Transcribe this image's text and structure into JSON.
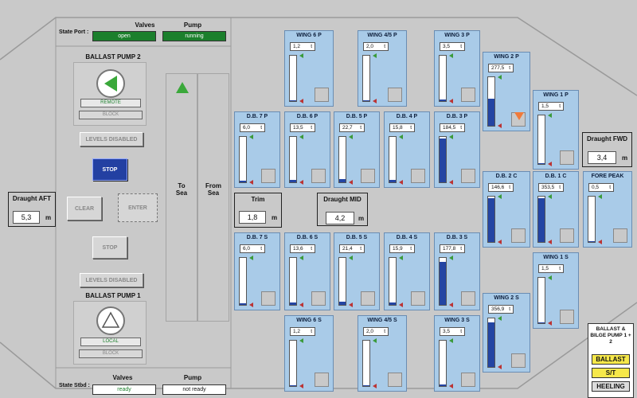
{
  "top_state": {
    "row_label": "State Port :",
    "valves_header": "Valves",
    "pump_header": "Pump",
    "valves_value": "open",
    "pump_value": "running"
  },
  "bottom_state": {
    "row_label": "State Stbd :",
    "valves_header": "Valves",
    "pump_header": "Pump",
    "valves_value": "ready",
    "pump_value": "not ready"
  },
  "pump2": {
    "title": "BALLAST PUMP 2",
    "status": "REMOTE",
    "block": "BLOCK",
    "levels": "LEVELS DISABLED",
    "stop": "STOP"
  },
  "pump1": {
    "title": "BALLAST PUMP 1",
    "status": "LOCAL",
    "block": "BLOCK",
    "levels": "LEVELS DISABLED",
    "stop": "STOP"
  },
  "controls": {
    "clear": "CLEAR",
    "enter": "ENTER"
  },
  "sea": {
    "to": "To\nSea",
    "from": "From\nSea"
  },
  "draught_aft": {
    "title": "Draught AFT",
    "value": "5,3",
    "unit": "m"
  },
  "draught_fwd": {
    "title": "Draught FWD",
    "value": "3,4",
    "unit": "m"
  },
  "draught_mid": {
    "title": "Draught MID",
    "value": "4,2",
    "unit": "m"
  },
  "trim": {
    "title": "Trim",
    "value": "1,8",
    "unit": "m"
  },
  "unit_t": "t",
  "tanks": [
    {
      "id": "wing6p",
      "name": "WING 6 P",
      "value": "1,2",
      "fill": 0.02
    },
    {
      "id": "wing45p",
      "name": "WING 4/5 P",
      "value": "2,0",
      "fill": 0.02
    },
    {
      "id": "wing3p",
      "name": "WING 3 P",
      "value": "3,5",
      "fill": 0.03
    },
    {
      "id": "wing2p",
      "name": "WING 2 P",
      "value": "277,5",
      "fill": 0.55
    },
    {
      "id": "wing1p",
      "name": "WING 1 P",
      "value": "1,5",
      "fill": 0.02
    },
    {
      "id": "db7p",
      "name": "D.B. 7 P",
      "value": "6,0",
      "fill": 0.03
    },
    {
      "id": "db6p",
      "name": "D.B. 6 P",
      "value": "13,5",
      "fill": 0.05
    },
    {
      "id": "db5p",
      "name": "D.B. 5 P",
      "value": "22,7",
      "fill": 0.07
    },
    {
      "id": "db4p",
      "name": "D.B. 4 P",
      "value": "15,8",
      "fill": 0.05
    },
    {
      "id": "db3p",
      "name": "D.B. 3 P",
      "value": "184,5",
      "fill": 0.97
    },
    {
      "id": "db2c",
      "name": "D.B. 2 C",
      "value": "146,6",
      "fill": 0.97
    },
    {
      "id": "db1c",
      "name": "D.B. 1 C",
      "value": "353,5",
      "fill": 0.97
    },
    {
      "id": "forepeak",
      "name": "FORE PEAK",
      "value": "0,5",
      "fill": 0.01
    },
    {
      "id": "db7s",
      "name": "D.B. 7 S",
      "value": "6,0",
      "fill": 0.03
    },
    {
      "id": "db6s",
      "name": "D.B. 6 S",
      "value": "13,6",
      "fill": 0.05
    },
    {
      "id": "db5s",
      "name": "D.B. 5 S",
      "value": "21,4",
      "fill": 0.07
    },
    {
      "id": "db4s",
      "name": "D.B. 4 S",
      "value": "15,9",
      "fill": 0.05
    },
    {
      "id": "db3s",
      "name": "D.B. 3 S",
      "value": "177,8",
      "fill": 0.92
    },
    {
      "id": "wing1s",
      "name": "WING 1 S",
      "value": "1,5",
      "fill": 0.02
    },
    {
      "id": "wing6s",
      "name": "WING 6 S",
      "value": "1,2",
      "fill": 0.02
    },
    {
      "id": "wing45s",
      "name": "WING 4/5 S",
      "value": "2,0",
      "fill": 0.02
    },
    {
      "id": "wing3s",
      "name": "WING 3 S",
      "value": "3,5",
      "fill": 0.03
    },
    {
      "id": "wing2s",
      "name": "WING 2 S",
      "value": "356,9",
      "fill": 0.92
    }
  ],
  "legend": {
    "title": "BALLAST & BILGE PUMP 1 + 2",
    "ballast": "BALLAST",
    "st": "S/T",
    "heeling": "HEELING"
  },
  "colors": {
    "tank_bg": "#a9cbe8",
    "fill": "#2445a3",
    "status_green": "#1b7f2c",
    "legend_yellow": "#f6e84a"
  }
}
